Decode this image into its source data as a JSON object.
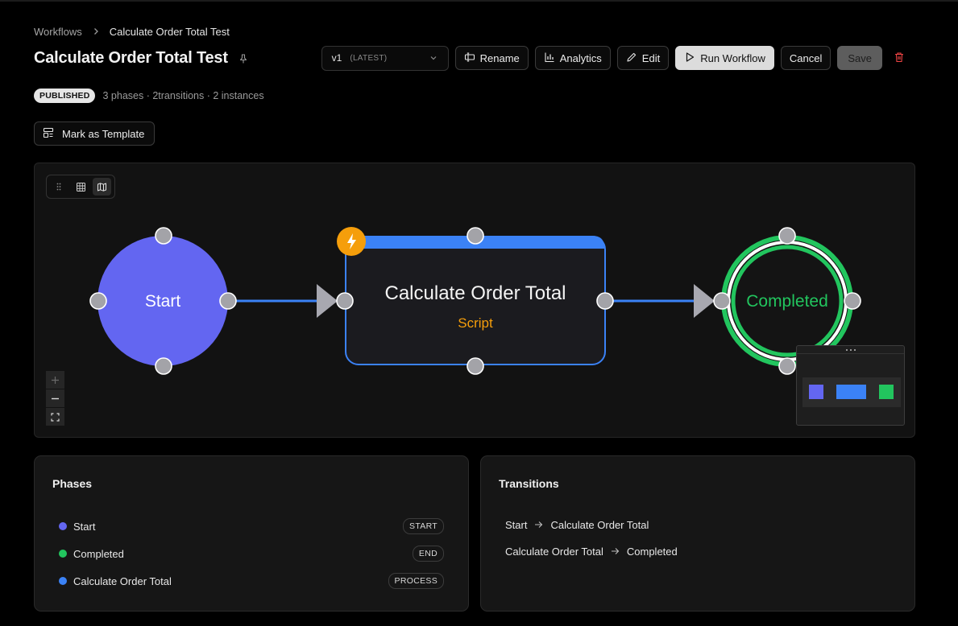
{
  "breadcrumb": {
    "root": "Workflows",
    "current": "Calculate Order Total Test"
  },
  "header": {
    "title": "Calculate Order Total Test"
  },
  "toolbar": {
    "version": "v1",
    "version_tag": "(LATEST)",
    "rename": "Rename",
    "analytics": "Analytics",
    "edit": "Edit",
    "run": "Run Workflow",
    "cancel": "Cancel",
    "save": "Save"
  },
  "status": {
    "badge": "PUBLISHED",
    "summary": "3 phases · 2transitions · 2 instances"
  },
  "template_button": "Mark as Template",
  "flow": {
    "nodes": [
      {
        "id": "start",
        "label": "Start",
        "color": "#6366f1"
      },
      {
        "id": "calc",
        "label": "Calculate Order Total",
        "sublabel": "Script",
        "color": "#3b82f6",
        "sublabel_color": "#f59e0b"
      },
      {
        "id": "completed",
        "label": "Completed",
        "color": "#22c55e"
      }
    ]
  },
  "phases": {
    "title": "Phases",
    "items": [
      {
        "name": "Start",
        "type": "START",
        "color": "#6366f1"
      },
      {
        "name": "Completed",
        "type": "END",
        "color": "#22c55e"
      },
      {
        "name": "Calculate Order Total",
        "type": "PROCESS",
        "color": "#3b82f6"
      }
    ]
  },
  "transitions": {
    "title": "Transitions",
    "items": [
      {
        "from": "Start",
        "to": "Calculate Order Total"
      },
      {
        "from": "Calculate Order Total",
        "to": "Completed"
      }
    ]
  },
  "colors": {
    "accent_blue": "#3b82f6",
    "start_purple": "#6366f1",
    "end_green": "#22c55e",
    "script_orange": "#f59e0b",
    "delete_red": "#ef4444"
  }
}
